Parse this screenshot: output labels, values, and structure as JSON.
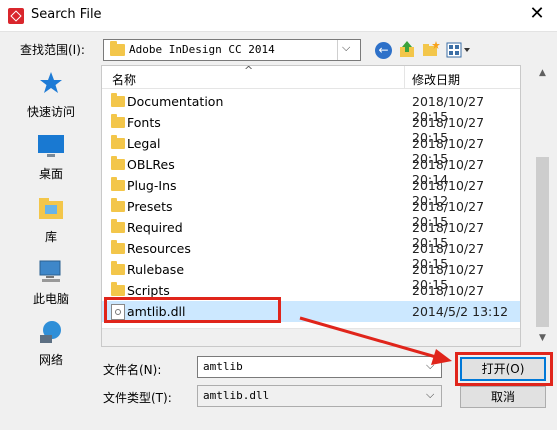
{
  "window": {
    "title": "Search File",
    "close_glyph": "✕"
  },
  "lookin": {
    "label": "查找范围(I):",
    "value": "Adobe InDesign CC 2014",
    "chevron": "⌵"
  },
  "toolbar": {
    "icons": [
      "back-icon",
      "up-folder-icon",
      "new-folder-icon",
      "view-menu-icon"
    ]
  },
  "places": [
    {
      "label": "快速访问",
      "icon": "star-icon"
    },
    {
      "label": "桌面",
      "icon": "desktop-icon"
    },
    {
      "label": "库",
      "icon": "library-icon"
    },
    {
      "label": "此电脑",
      "icon": "computer-icon"
    },
    {
      "label": "网络",
      "icon": "network-icon"
    }
  ],
  "filelist": {
    "columns": {
      "name": "名称",
      "date": "修改日期"
    },
    "sort_glyph": "^",
    "rows": [
      {
        "name": "Documentation",
        "date": "2018/10/27 20:15",
        "type": "folder"
      },
      {
        "name": "Fonts",
        "date": "2018/10/27 20:15",
        "type": "folder"
      },
      {
        "name": "Legal",
        "date": "2018/10/27 20:15",
        "type": "folder"
      },
      {
        "name": "OBLRes",
        "date": "2018/10/27 20:14",
        "type": "folder"
      },
      {
        "name": "Plug-Ins",
        "date": "2018/10/27 20:12",
        "type": "folder"
      },
      {
        "name": "Presets",
        "date": "2018/10/27 20:15",
        "type": "folder"
      },
      {
        "name": "Required",
        "date": "2018/10/27 20:15",
        "type": "folder"
      },
      {
        "name": "Resources",
        "date": "2018/10/27 20:15",
        "type": "folder"
      },
      {
        "name": "Rulebase",
        "date": "2018/10/27 20:15",
        "type": "folder"
      },
      {
        "name": "Scripts",
        "date": "2018/10/27 20:15",
        "type": "folder"
      },
      {
        "name": "amtlib.dll",
        "date": "2014/5/2 13:12",
        "type": "dll",
        "selected": true
      }
    ]
  },
  "filename": {
    "label": "文件名(N):",
    "value": "amtlib"
  },
  "filetype": {
    "label": "文件类型(T):",
    "value": "amtlib.dll"
  },
  "buttons": {
    "open": "打开(O)",
    "cancel": "取消"
  },
  "colors": {
    "accent": "#0078d7",
    "selection": "#cce8ff",
    "annotation": "#e0251b",
    "folder": "#f3c64a"
  }
}
